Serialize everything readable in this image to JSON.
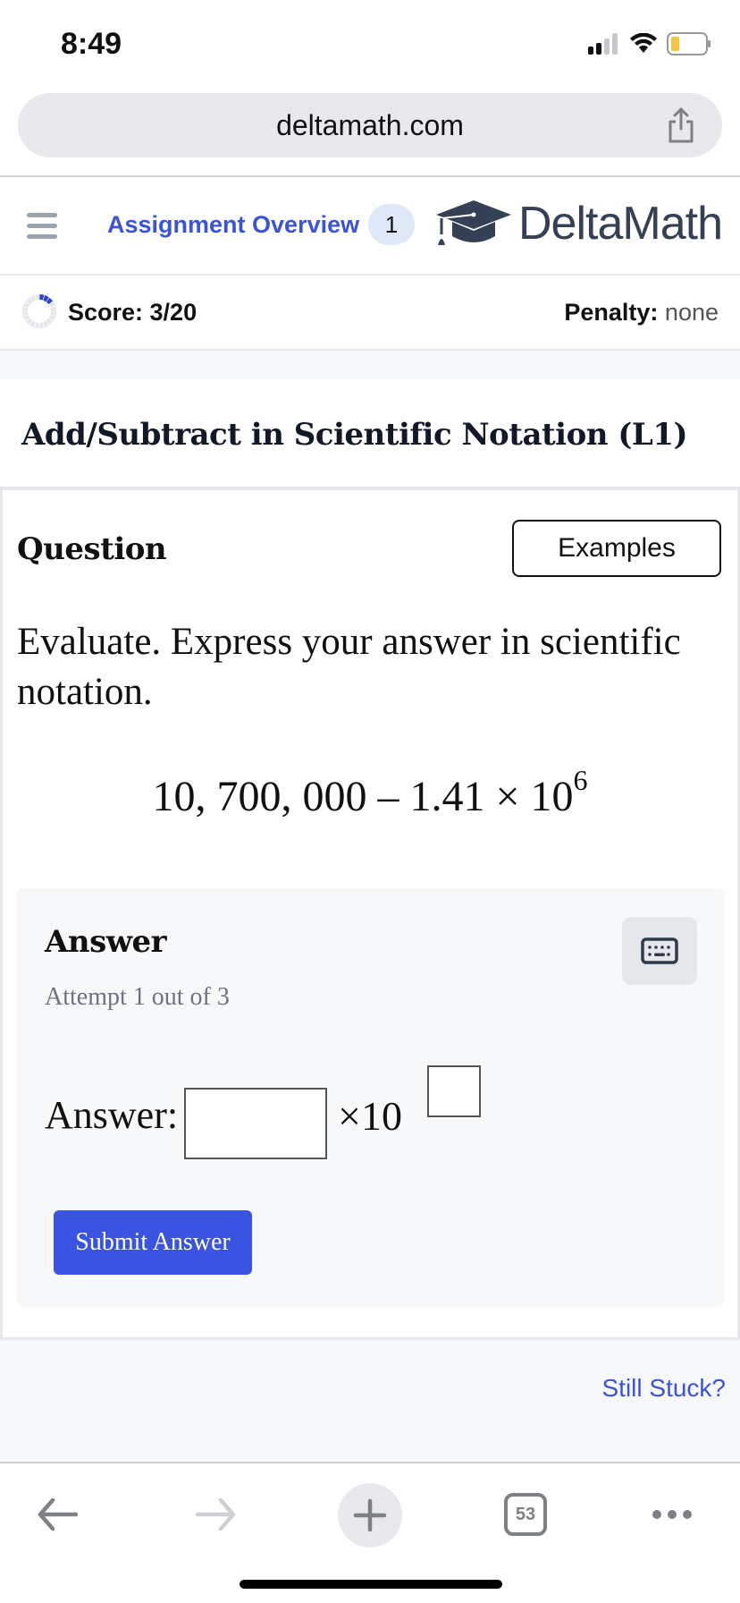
{
  "status_bar": {
    "time": "8:49",
    "signal_icon": "cellular-signal-icon",
    "wifi_icon": "wifi-icon",
    "battery_icon": "battery-low-icon",
    "battery_color": "#f5c542"
  },
  "browser": {
    "url": "deltamath.com",
    "share_icon": "share-icon",
    "toolbar": {
      "back_icon": "back-arrow-icon",
      "forward_icon": "forward-arrow-icon",
      "new_tab_icon": "plus-icon",
      "tab_count": "53",
      "more_icon": "more-dots-icon"
    }
  },
  "header": {
    "menu_icon": "hamburger-menu-icon",
    "assignment_overview_label": "Assignment Overview",
    "assignment_badge": "1",
    "logo_icon": "graduation-cap-icon",
    "logo_text": "DeltaMath",
    "accent_color": "#3a53db"
  },
  "score": {
    "label": "Score: 3/20",
    "earned": 3,
    "total": 20,
    "penalty_label": "Penalty:",
    "penalty_value": "none"
  },
  "problem": {
    "title": "Add/Subtract in Scientific Notation (L1)",
    "question_heading": "Question",
    "examples_button": "Examples",
    "prompt": "Evaluate. Express your answer in scientific notation.",
    "expression_base": "10, 700, 000 – 1.41 × 10",
    "expression_exponent": "6"
  },
  "answer": {
    "heading": "Answer",
    "attempt_text": "Attempt 1 out of 3",
    "keyboard_icon": "keyboard-icon",
    "label": "Answer:",
    "mantissa_value": "",
    "times_ten": "×10",
    "exponent_value": "",
    "submit_label": "Submit Answer",
    "submit_color": "#3a53e0"
  },
  "footer": {
    "still_stuck": "Still Stuck?"
  }
}
